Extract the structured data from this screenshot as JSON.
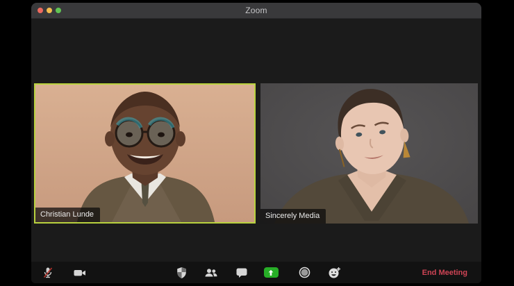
{
  "window": {
    "title": "Zoom"
  },
  "titlebar": {
    "traffic_lights": [
      "close",
      "minimize",
      "zoom"
    ]
  },
  "participants": [
    {
      "name": "Christian Lunde",
      "active_speaker": true,
      "position": "left"
    },
    {
      "name": "Sincerely Media",
      "active_speaker": false,
      "position": "right"
    }
  ],
  "toolbar": {
    "buttons": [
      {
        "id": "mute",
        "icon": "mic-muted-icon",
        "state": "muted"
      },
      {
        "id": "video",
        "icon": "video-camera-icon",
        "state": "on"
      },
      {
        "id": "security",
        "icon": "shield-icon"
      },
      {
        "id": "participants",
        "icon": "participants-icon"
      },
      {
        "id": "chat",
        "icon": "chat-bubble-icon"
      },
      {
        "id": "share-screen",
        "icon": "share-screen-icon"
      },
      {
        "id": "record",
        "icon": "record-icon"
      },
      {
        "id": "reactions",
        "icon": "reactions-icon"
      }
    ],
    "end_meeting_label": "End Meeting"
  },
  "colors": {
    "active_speaker_border": "#b9d23e",
    "share_screen_green": "#27ae27",
    "end_meeting_red": "#cf4455",
    "mic_muted_slash": "#b5342e",
    "traffic_red": "#ee6a5f",
    "traffic_yellow": "#f5bd4f",
    "traffic_green": "#61c454",
    "titlebar_bg": "#39393b",
    "toolbar_bg": "#121212",
    "content_bg": "#1b1b1b"
  }
}
